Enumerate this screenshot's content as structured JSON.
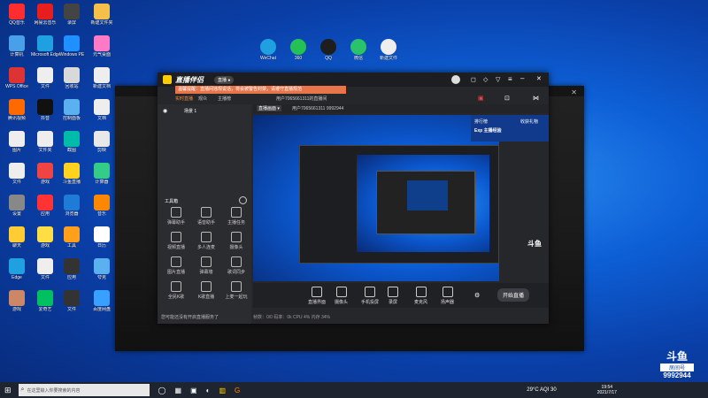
{
  "desktop_icons": [
    {
      "label": "QQ音乐",
      "color": "#ff2d2d"
    },
    {
      "label": "网易云音乐",
      "color": "#e61e1e"
    },
    {
      "label": "录屏",
      "color": "#444"
    },
    {
      "label": "新建文件夹",
      "color": "#f5c04a"
    },
    {
      "label": "计算机",
      "color": "#4aa0e8"
    },
    {
      "label": "Microsoft Edge",
      "color": "#1fa0e0"
    },
    {
      "label": "Windows PE",
      "color": "#1e90ff"
    },
    {
      "label": "元气桌面",
      "color": "#ff7ac6"
    },
    {
      "label": "WPS Office",
      "color": "#d33"
    },
    {
      "label": "文件",
      "color": "#eee"
    },
    {
      "label": "回收站",
      "color": "#d9d9d9"
    },
    {
      "label": "新建文档",
      "color": "#eee"
    },
    {
      "label": "腾讯视频",
      "color": "#ff6a00"
    },
    {
      "label": "抖音",
      "color": "#111"
    },
    {
      "label": "控制面板",
      "color": "#5bb0ef"
    },
    {
      "label": "文档",
      "color": "#eee"
    },
    {
      "label": "图片",
      "color": "#eee"
    },
    {
      "label": "文件夹",
      "color": "#eee"
    },
    {
      "label": "截图",
      "color": "#0ba"
    },
    {
      "label": "剪映",
      "color": "#e8e8e8"
    },
    {
      "label": "文件",
      "color": "#eee"
    },
    {
      "label": "游戏",
      "color": "#e44"
    },
    {
      "label": "斗鱼直播",
      "color": "#ffd21f"
    },
    {
      "label": "计算器",
      "color": "#3c8"
    },
    {
      "label": "设置",
      "color": "#888"
    },
    {
      "label": "应用",
      "color": "#f33"
    },
    {
      "label": "浏览器",
      "color": "#1e7bd8"
    },
    {
      "label": "音乐",
      "color": "#f80"
    },
    {
      "label": "聊天",
      "color": "#ffcc33"
    },
    {
      "label": "游戏",
      "color": "#ffdd44"
    },
    {
      "label": "工具",
      "color": "#ff9f1a"
    },
    {
      "label": "日历",
      "color": "#fff"
    },
    {
      "label": "Edge",
      "color": "#1fa0e0"
    },
    {
      "label": "文件",
      "color": "#eee"
    },
    {
      "label": "应用",
      "color": "#333"
    },
    {
      "label": "夸克",
      "color": "#5bb0ef"
    },
    {
      "label": "游戏",
      "color": "#c86"
    },
    {
      "label": "爱奇艺",
      "color": "#00c060"
    },
    {
      "label": "文件",
      "color": "#333"
    },
    {
      "label": "百度网盘",
      "color": "#3aa0ff"
    }
  ],
  "desktop_icons_top": [
    {
      "label": "WeChat",
      "color": "#1fa0e0"
    },
    {
      "label": "360",
      "color": "#24c156"
    },
    {
      "label": "QQ",
      "color": "#1e1e1e"
    },
    {
      "label": "微信",
      "color": "#2ac26a"
    },
    {
      "label": "新建文件",
      "color": "#eee"
    }
  ],
  "app": {
    "title": "直播伴侣",
    "badge": "直播 ●",
    "notice": "温馨提醒：直播间违规说话，将会被警告封禁，请遵守直播规范",
    "user_id": "用户7065661311的直播间",
    "tabs": [
      "实时直播",
      "观众",
      "主播榜"
    ],
    "left_items": [
      "全屏",
      "场景 1"
    ],
    "tools_header": "工具箱",
    "tools": [
      {
        "label": "弹幕助手"
      },
      {
        "label": "语音助手"
      },
      {
        "label": "主播任务"
      },
      {
        "label": "视频直播"
      },
      {
        "label": "多人连麦"
      },
      {
        "label": "摄像头"
      },
      {
        "label": "图片直播"
      },
      {
        "label": "弹幕墙"
      },
      {
        "label": "歌词同步"
      },
      {
        "label": "全民K歌"
      },
      {
        "label": "K歌直播"
      },
      {
        "label": "上麦一起玩"
      }
    ],
    "stage_header": "直播画面 ▾",
    "stage_info": "用户7065661311  9992944",
    "side_panel": {
      "line1": "排行榜",
      "line2": "Exp 主播经验",
      "line3": "收获礼物"
    },
    "bottom_actions": [
      "直播界面",
      "摄像头",
      "手机投屏",
      "录屏",
      "麦克风",
      "扬声器"
    ],
    "go_live": "开始直播",
    "status": "在线观看人数：0    帧率：30   CPU：4%    内存：41%",
    "status2": "帧数：0/0      码率：0k   CPU 4%  内存 34%",
    "bottom_hint": "您可能还没有开启直播服务了"
  },
  "taskbar": {
    "search_placeholder": "在这里输入你要搜索的内容",
    "weather": "29°C  AQI 30",
    "time": "19:54",
    "date": "2021/7/17"
  },
  "watermark": {
    "brand": "斗鱼",
    "label": "房间号",
    "room": "9992944"
  }
}
